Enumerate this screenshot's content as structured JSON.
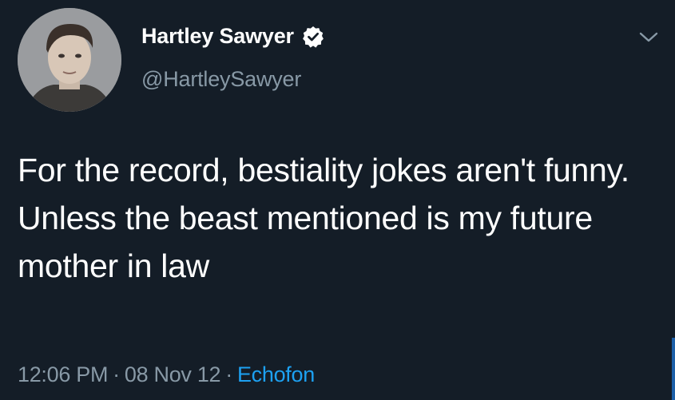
{
  "tweet": {
    "author": {
      "display_name": "Hartley Sawyer",
      "handle": "@HartleySawyer",
      "verified": true
    },
    "text": "For the record, bestiality jokes aren't funny. Unless the beast mentioned is my future mother in law",
    "time": "12:06 PM",
    "date": "08 Nov 12",
    "separator": "·",
    "source": "Echofon"
  },
  "icons": {
    "verified": "verified-badge-icon",
    "menu": "chevron-down-icon"
  },
  "colors": {
    "background": "#141d27",
    "text": "#ffffff",
    "muted": "#8899a6",
    "link": "#1da1f2"
  }
}
